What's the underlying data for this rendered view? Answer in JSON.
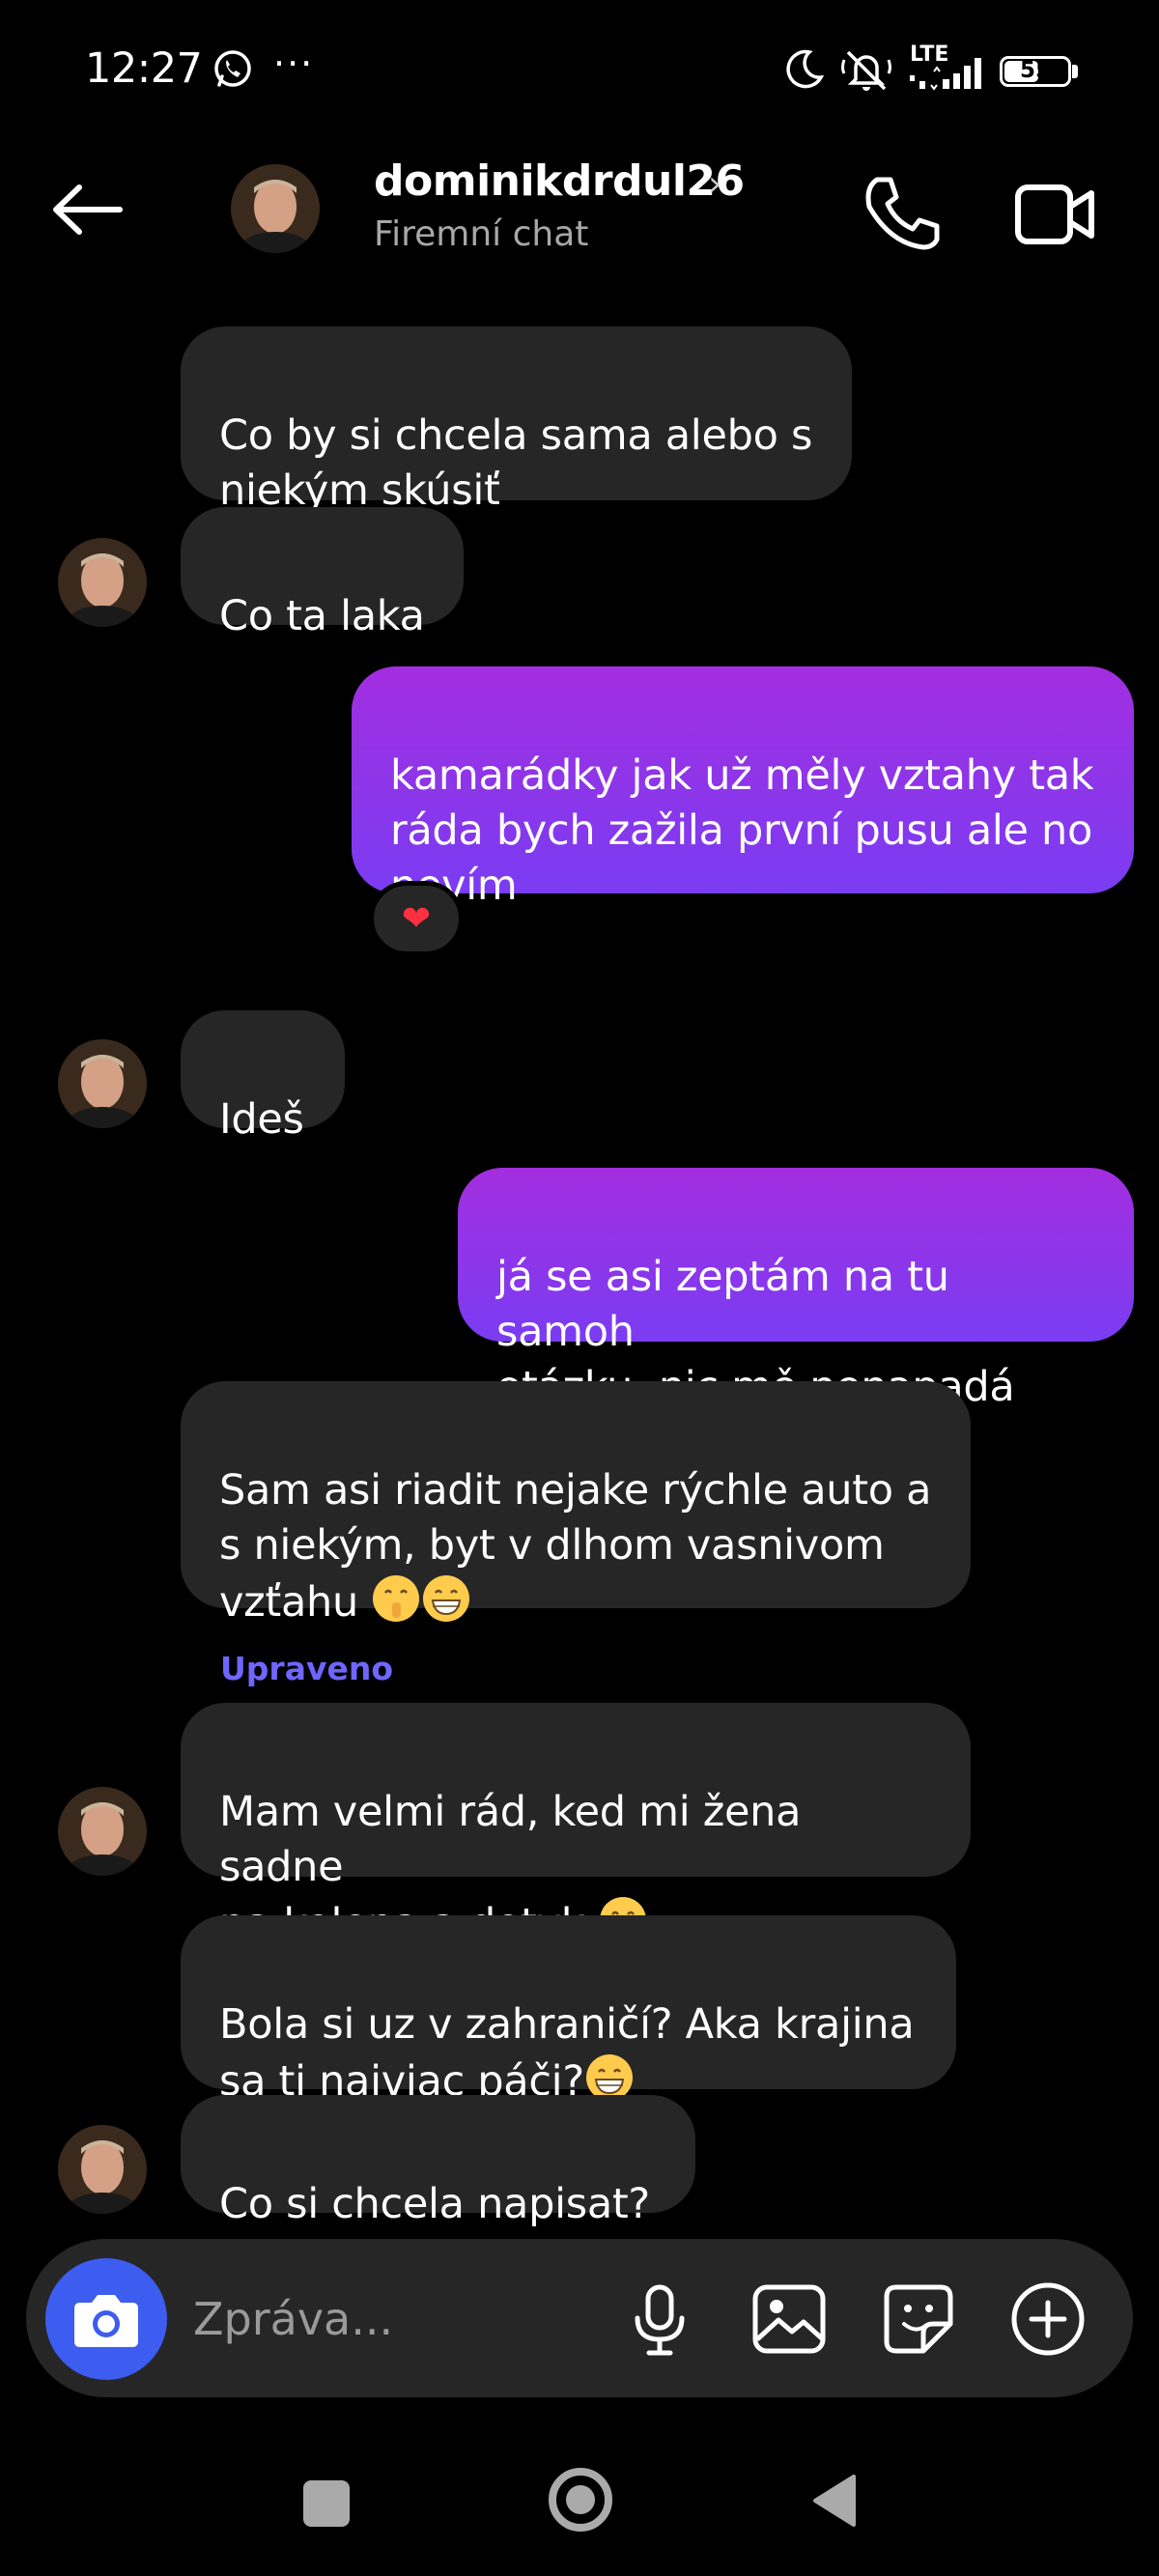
{
  "status_bar": {
    "time": "12:27",
    "dots": "···",
    "network": "LTE",
    "battery": "55",
    "battery_level": 0.55
  },
  "header": {
    "username": "dominikdrdul26",
    "chevron": "›",
    "subtitle": "Firemní chat"
  },
  "messages": [
    {
      "id": "m1",
      "side": "in",
      "text": "Co by si chcela sama alebo s\nniekým skúsiť"
    },
    {
      "id": "m2",
      "side": "in",
      "text": "Co ta laka"
    },
    {
      "id": "m3",
      "side": "out",
      "text": "kamarádky jak už měly vztahy tak\nráda bych zažila první pusu ale no\nnevím",
      "reaction": "❤"
    },
    {
      "id": "m4",
      "side": "in",
      "text": "Ideš"
    },
    {
      "id": "m5",
      "side": "out",
      "text": "já se asi zeptám na tu samoh\notázku, nic mě nenapadá"
    },
    {
      "id": "m6",
      "side": "in",
      "text": "Sam asi riadit nejake rýchle auto a\ns niekým, byt v dlhom vasnivom\nvzťahu",
      "emojis": [
        "shushing-face",
        "grinning-face"
      ]
    },
    {
      "id": "m7",
      "side": "in",
      "edited_label": "Upraveno",
      "text": "Mam velmi rád, ked mi žena sadne\nna kolena a dotyk",
      "emojis": [
        "grinning-face"
      ]
    },
    {
      "id": "m8",
      "side": "in",
      "text": "Bola si uz v zahraničí? Aka krajina\nsa ti najviac páči?",
      "emojis": [
        "grinning-face"
      ]
    },
    {
      "id": "m9",
      "side": "in",
      "text": "Co si chcela napisat?"
    }
  ],
  "composer": {
    "placeholder": "Zpráva..."
  },
  "icons": {
    "whatsapp": "whatsapp-icon",
    "moon": "dnd-moon-icon",
    "bell_off": "bell-off-icon",
    "signal": "signal-icon",
    "back": "back-arrow-icon",
    "call": "phone-icon",
    "video": "video-camera-icon",
    "camera": "camera-icon",
    "mic": "microphone-icon",
    "gallery": "gallery-icon",
    "sticker": "sticker-icon",
    "plus": "plus-circle-icon"
  },
  "colors": {
    "incoming_bubble": "#262626",
    "outgoing_top": "#a32ee0",
    "outgoing_bottom": "#7a3cf2",
    "accent_blue": "#3d5cf0",
    "edited_label": "#6e66ff"
  }
}
